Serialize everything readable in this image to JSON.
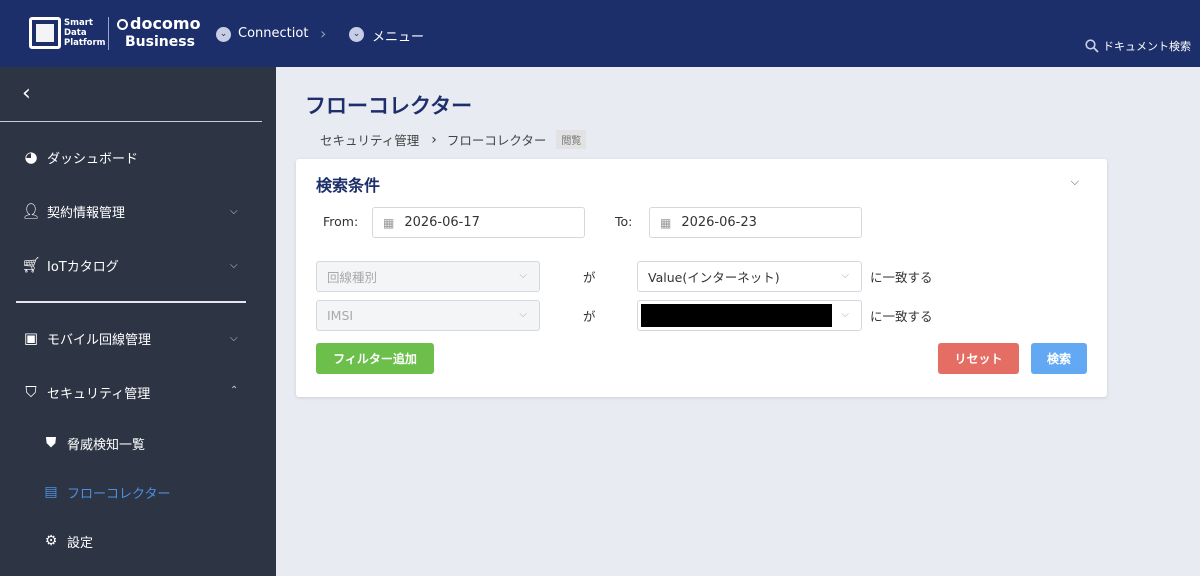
{
  "header": {
    "sdp_logo_lines": [
      "Smart",
      "Data",
      "Platform"
    ],
    "brand_top": "docomo",
    "brand_bottom": "Business",
    "breadcrumb": [
      {
        "label": "Connectiot",
        "icon": "chevron-down-circle-icon"
      },
      {
        "label": "メニュー",
        "icon": "chevron-down-circle-icon"
      }
    ],
    "doc_search_label": "ドキュメント検索"
  },
  "sidebar": {
    "items": [
      {
        "label": "ダッシュボード",
        "icon": "dashboard-gauge-icon",
        "expandable": false
      },
      {
        "label": "契約情報管理",
        "icon": "user-icon",
        "expandable": true
      },
      {
        "label": "IoTカタログ",
        "icon": "cart-icon",
        "expandable": true
      },
      {
        "label": "モバイル回線管理",
        "icon": "sim-card-icon",
        "expandable": true
      },
      {
        "label": "セキュリティ管理",
        "icon": "shield-check-icon",
        "expandable": true,
        "expanded": true
      }
    ],
    "subitems": [
      {
        "label": "脅威検知一覧",
        "icon": "shield-alert-icon"
      },
      {
        "label": "フローコレクター",
        "icon": "document-chart-icon",
        "active": true
      },
      {
        "label": "設定",
        "icon": "gear-icon"
      }
    ]
  },
  "main": {
    "title": "フローコレクター",
    "breadcrumb": [
      "セキュリティ管理",
      "フローコレクター"
    ],
    "breadcrumb_badge": "閲覧",
    "search": {
      "title": "検索条件",
      "from_label": "From:",
      "from_value": "2026-06-17",
      "to_label": "To:",
      "to_value": "2026-06-23",
      "filters": [
        {
          "field": "回線種別",
          "operator": "が",
          "value": "Value(インターネット)",
          "match": "に一致する",
          "redacted": false
        },
        {
          "field": "IMSI",
          "operator": "が",
          "value": "",
          "match": "に一致する",
          "redacted": true
        }
      ],
      "add_filter_label": "フィルター追加",
      "reset_label": "リセット",
      "search_label": "検索"
    }
  },
  "colors": {
    "header_bg": "#1c2f6b",
    "sidebar_bg": "#2d3544",
    "active_link": "#4e8fe0",
    "add_filter": "#6bbf4a",
    "reset": "#e46e64",
    "search": "#63a8f3"
  }
}
